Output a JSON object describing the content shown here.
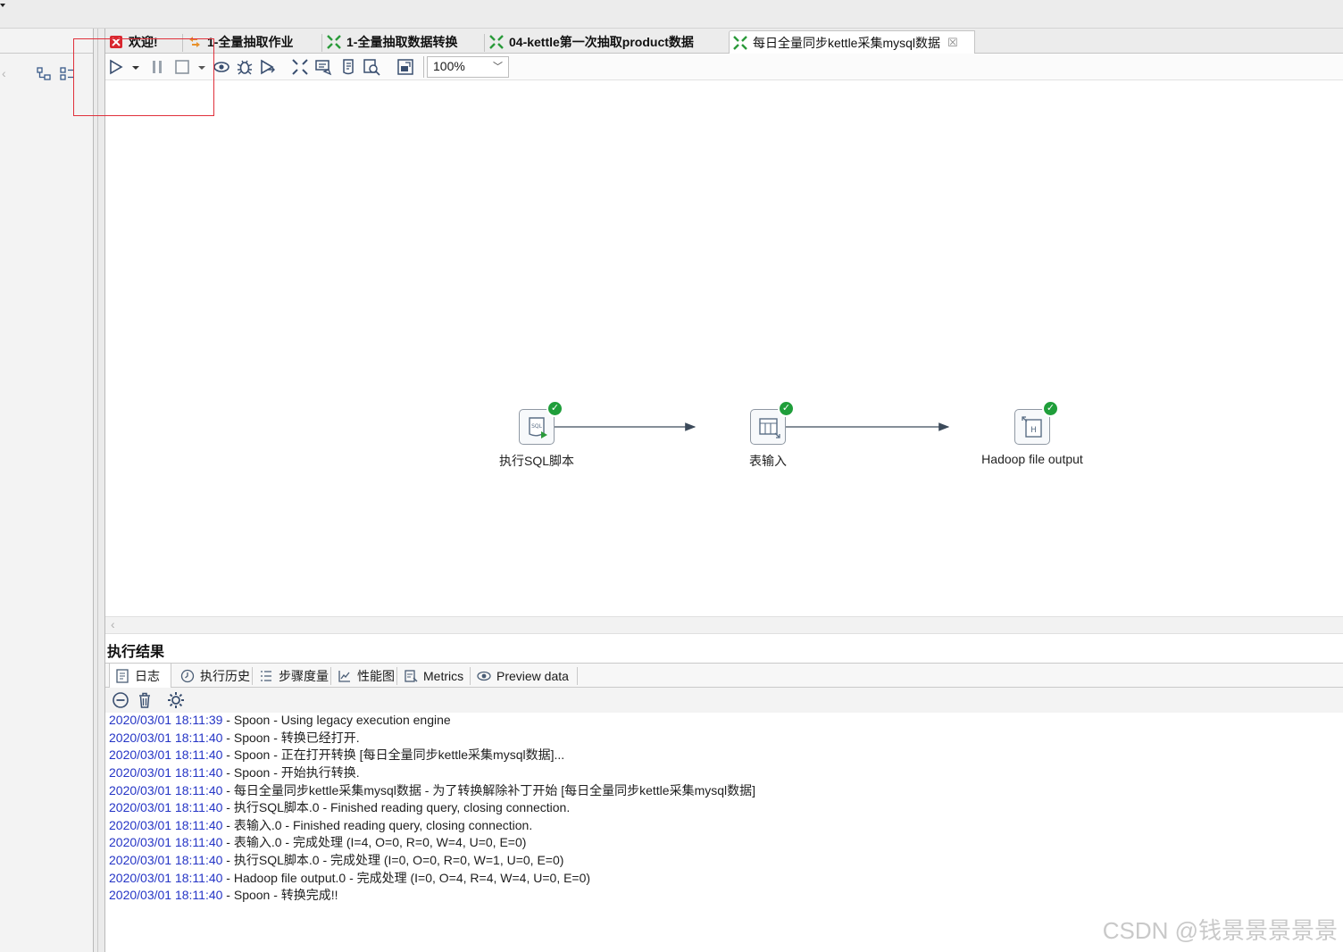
{
  "tabs": [
    {
      "label": "欢迎!",
      "icon": "welcome-icon",
      "active": false
    },
    {
      "label": "1-全量抽取作业",
      "icon": "job-icon",
      "active": false
    },
    {
      "label": "1-全量抽取数据转换",
      "icon": "transformation-icon",
      "active": false
    },
    {
      "label": "04-kettle第一次抽取product数据",
      "icon": "transformation-icon",
      "active": false
    },
    {
      "label": "每日全量同步kettle采集mysql数据",
      "icon": "transformation-icon",
      "active": true,
      "close": "☒"
    }
  ],
  "toolbar": {
    "icons": [
      "run-icon",
      "run-dropdown-icon",
      "pause-icon",
      "stop-icon",
      "stop-dropdown-icon",
      "preview-icon",
      "debug-icon",
      "replay-icon",
      "verify-icon",
      "impact-icon",
      "sql-icon",
      "explore-db-icon",
      "show-results-icon"
    ],
    "zoom": "100%"
  },
  "colors": {
    "annotation": "#e0303b",
    "check": "#1f9e3a",
    "timestamp": "#2535c6",
    "hop": "#3c4a5a"
  },
  "steps": [
    {
      "label": "执行SQL脚本",
      "icon": "sql-script-icon"
    },
    {
      "label": "表输入",
      "icon": "table-input-icon"
    },
    {
      "label": "Hadoop file output",
      "icon": "hadoop-file-output-icon"
    }
  ],
  "results": {
    "title": "执行结果",
    "tabs": [
      {
        "label": "日志",
        "icon": "log-icon"
      },
      {
        "label": "执行历史",
        "icon": "history-icon"
      },
      {
        "label": "步骤度量",
        "icon": "step-metrics-icon"
      },
      {
        "label": "性能图",
        "icon": "performance-graph-icon"
      },
      {
        "label": "Metrics",
        "icon": "metrics-icon"
      },
      {
        "label": "Preview data",
        "icon": "preview-data-icon"
      }
    ],
    "log_tools": [
      "hide-icon",
      "clear-log-icon",
      "log-settings-icon"
    ],
    "log": [
      {
        "ts": "2020/03/01 18:11:39",
        "msg": " - Spoon - Using legacy execution engine"
      },
      {
        "ts": "2020/03/01 18:11:40",
        "msg": " - Spoon - 转换已经打开."
      },
      {
        "ts": "2020/03/01 18:11:40",
        "msg": " - Spoon - 正在打开转换 [每日全量同步kettle采集mysql数据]..."
      },
      {
        "ts": "2020/03/01 18:11:40",
        "msg": " - Spoon - 开始执行转换."
      },
      {
        "ts": "2020/03/01 18:11:40",
        "msg": " - 每日全量同步kettle采集mysql数据 - 为了转换解除补丁开始  [每日全量同步kettle采集mysql数据]"
      },
      {
        "ts": "2020/03/01 18:11:40",
        "msg": " - 执行SQL脚本.0 - Finished reading query, closing connection."
      },
      {
        "ts": "2020/03/01 18:11:40",
        "msg": " - 表输入.0 - Finished reading query, closing connection."
      },
      {
        "ts": "2020/03/01 18:11:40",
        "msg": " - 表输入.0 - 完成处理 (I=4, O=0, R=0, W=4, U=0, E=0)"
      },
      {
        "ts": "2020/03/01 18:11:40",
        "msg": " - 执行SQL脚本.0 - 完成处理 (I=0, O=0, R=0, W=1, U=0, E=0)"
      },
      {
        "ts": "2020/03/01 18:11:40",
        "msg": " - Hadoop file output.0 - 完成处理 (I=0, O=4, R=4, W=4, U=0, E=0)"
      },
      {
        "ts": "2020/03/01 18:11:40",
        "msg": " - Spoon - 转换完成!!"
      }
    ]
  },
  "watermark": "CSDN @钱景景景景景"
}
